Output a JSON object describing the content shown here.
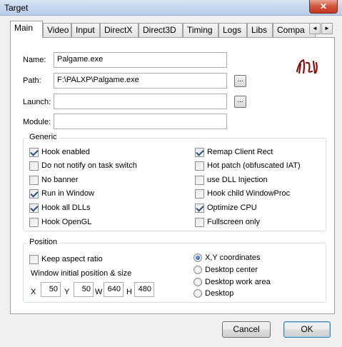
{
  "window": {
    "title": "Target",
    "close_glyph": "✕"
  },
  "tabs": [
    {
      "label": "Main",
      "active": true
    },
    {
      "label": "Video"
    },
    {
      "label": "Input"
    },
    {
      "label": "DirectX"
    },
    {
      "label": "Direct3D"
    },
    {
      "label": "Timing"
    },
    {
      "label": "Logs"
    },
    {
      "label": "Libs"
    },
    {
      "label": "Compa"
    }
  ],
  "tab_scroll": {
    "left": "◄",
    "right": "►"
  },
  "main": {
    "name_label": "Name:",
    "name_value": "Palgame.exe",
    "path_label": "Path:",
    "path_value": "F:\\PALXP\\Palgame.exe",
    "launch_label": "Launch:",
    "launch_value": "",
    "module_label": "Module:",
    "module_value": "",
    "browse_label": "...",
    "logo_icon": "pal-logo-icon"
  },
  "generic": {
    "title": "Generic",
    "left": [
      {
        "label": "Hook enabled",
        "checked": true
      },
      {
        "label": "Do not notify on task switch",
        "checked": false
      },
      {
        "label": "No banner",
        "checked": false
      },
      {
        "label": "Run in Window",
        "checked": true
      },
      {
        "label": "Hook all DLLs",
        "checked": true
      },
      {
        "label": "Hook OpenGL",
        "checked": false
      }
    ],
    "right": [
      {
        "label": "Remap Client Rect",
        "checked": true
      },
      {
        "label": "Hot patch (obfuscated IAT)",
        "checked": false
      },
      {
        "label": "use DLL Injection",
        "checked": false
      },
      {
        "label": "Hook child WindowProc",
        "checked": false
      },
      {
        "label": "Optimize CPU",
        "checked": true
      },
      {
        "label": "Fullscreen only",
        "checked": false
      }
    ]
  },
  "position": {
    "title": "Position",
    "keep_aspect_label": "Keep aspect ratio",
    "keep_aspect_checked": false,
    "initial_label": "Window initial position & size",
    "x_label": "X",
    "x_value": "50",
    "y_label": "Y",
    "y_value": "50",
    "w_label": "W",
    "w_value": "640",
    "h_label": "H",
    "h_value": "480",
    "radios": [
      {
        "label": "X,Y coordinates",
        "checked": true
      },
      {
        "label": "Desktop center",
        "checked": false
      },
      {
        "label": "Desktop work area",
        "checked": false
      },
      {
        "label": "Desktop",
        "checked": false
      }
    ]
  },
  "buttons": {
    "cancel": "Cancel",
    "ok": "OK"
  }
}
